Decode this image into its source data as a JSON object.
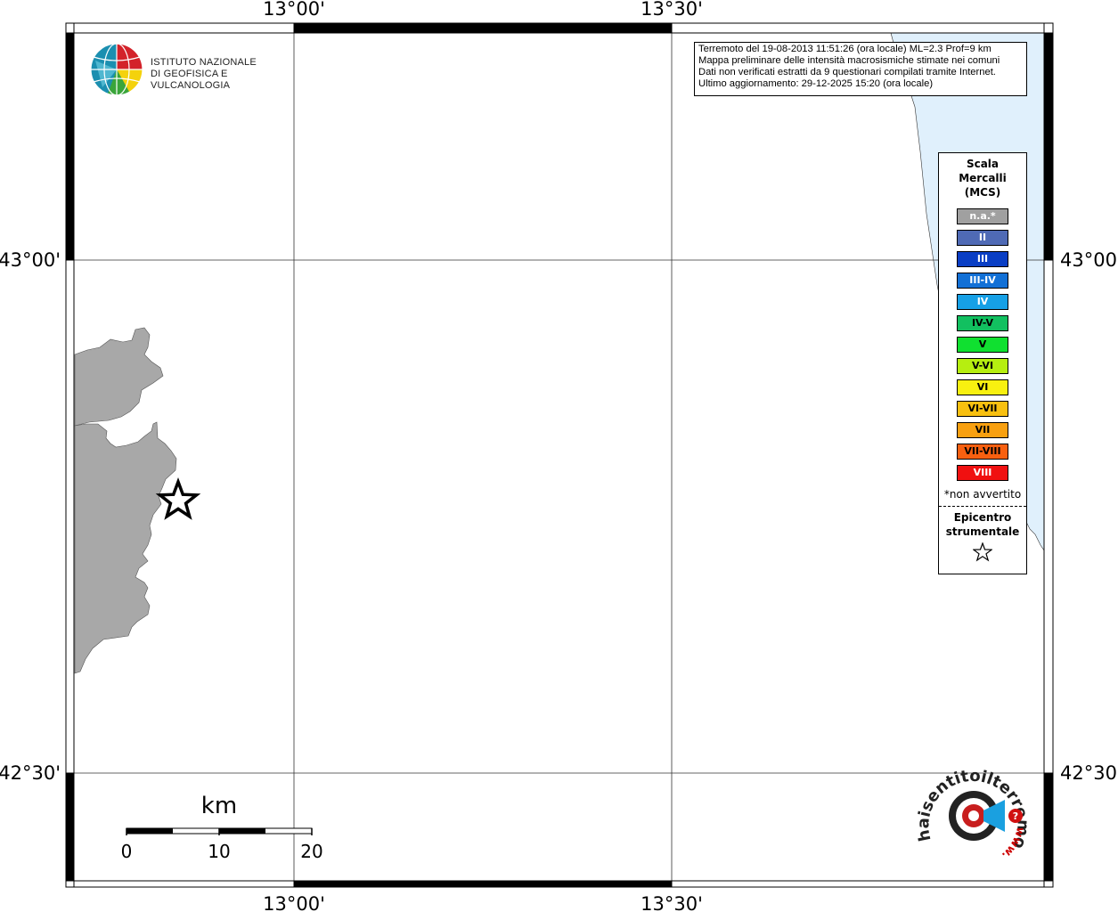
{
  "map": {
    "lon_labels": [
      "13°00'",
      "13°30'"
    ],
    "lat_labels": [
      "43°00'",
      "42°30'"
    ],
    "colors": {
      "land": "#a8a8a8",
      "sea": "#e0f0fc",
      "frame": "#000000"
    }
  },
  "header_logo": {
    "icon": "globe-icon",
    "line1": "ISTITUTO NAZIONALE",
    "line2": "DI GEOFISICA E VULCANOLOGIA"
  },
  "info": {
    "line1": "Terremoto del 19-08-2013 11:51:26 (ora locale) ML=2.3 Prof=9 km",
    "line2": "Mappa preliminare delle intensità macrosismiche stimate nei comuni",
    "line3": "Dati non verificati estratti da 9 questionari compilati tramite Internet.",
    "line4": "Ultimo aggiornamento: 29-12-2025 15:20 (ora locale)"
  },
  "legend": {
    "title_line1": "Scala",
    "title_line2": "Mercalli",
    "title_line3": "(MCS)",
    "items": [
      {
        "label": "n.a.*",
        "color": "#a0a0a0",
        "text_color": "#ffffff"
      },
      {
        "label": "II",
        "color": "#4f6ab5",
        "text_color": "#ffffff"
      },
      {
        "label": "III",
        "color": "#0a3ec4",
        "text_color": "#ffffff"
      },
      {
        "label": "III-IV",
        "color": "#1270d6",
        "text_color": "#ffffff"
      },
      {
        "label": "IV",
        "color": "#16a0e6",
        "text_color": "#ffffff"
      },
      {
        "label": "IV-V",
        "color": "#12c060",
        "text_color": "#000000"
      },
      {
        "label": "V",
        "color": "#10e030",
        "text_color": "#000000"
      },
      {
        "label": "V-VI",
        "color": "#b6ee10",
        "text_color": "#000000"
      },
      {
        "label": "VI",
        "color": "#f8f010",
        "text_color": "#000000"
      },
      {
        "label": "VI-VII",
        "color": "#f8c010",
        "text_color": "#000000"
      },
      {
        "label": "VII",
        "color": "#f8a010",
        "text_color": "#000000"
      },
      {
        "label": "VII-VIII",
        "color": "#f86010",
        "text_color": "#000000"
      },
      {
        "label": "VIII",
        "color": "#f01010",
        "text_color": "#ffffff"
      }
    ],
    "note": "*non avvertito",
    "epi_line1": "Epicentro",
    "epi_line2": "strumentale",
    "epi_icon": "star-outline-icon"
  },
  "scale_bar": {
    "unit": "km",
    "labels": [
      "0",
      "10",
      "20"
    ]
  },
  "footer_logo": {
    "icon": "target-megaphone-icon",
    "ring_text": "haisentitoilterremoto.it",
    "url_text": "www."
  },
  "epicenter": {
    "icon": "star-epicenter-icon"
  }
}
